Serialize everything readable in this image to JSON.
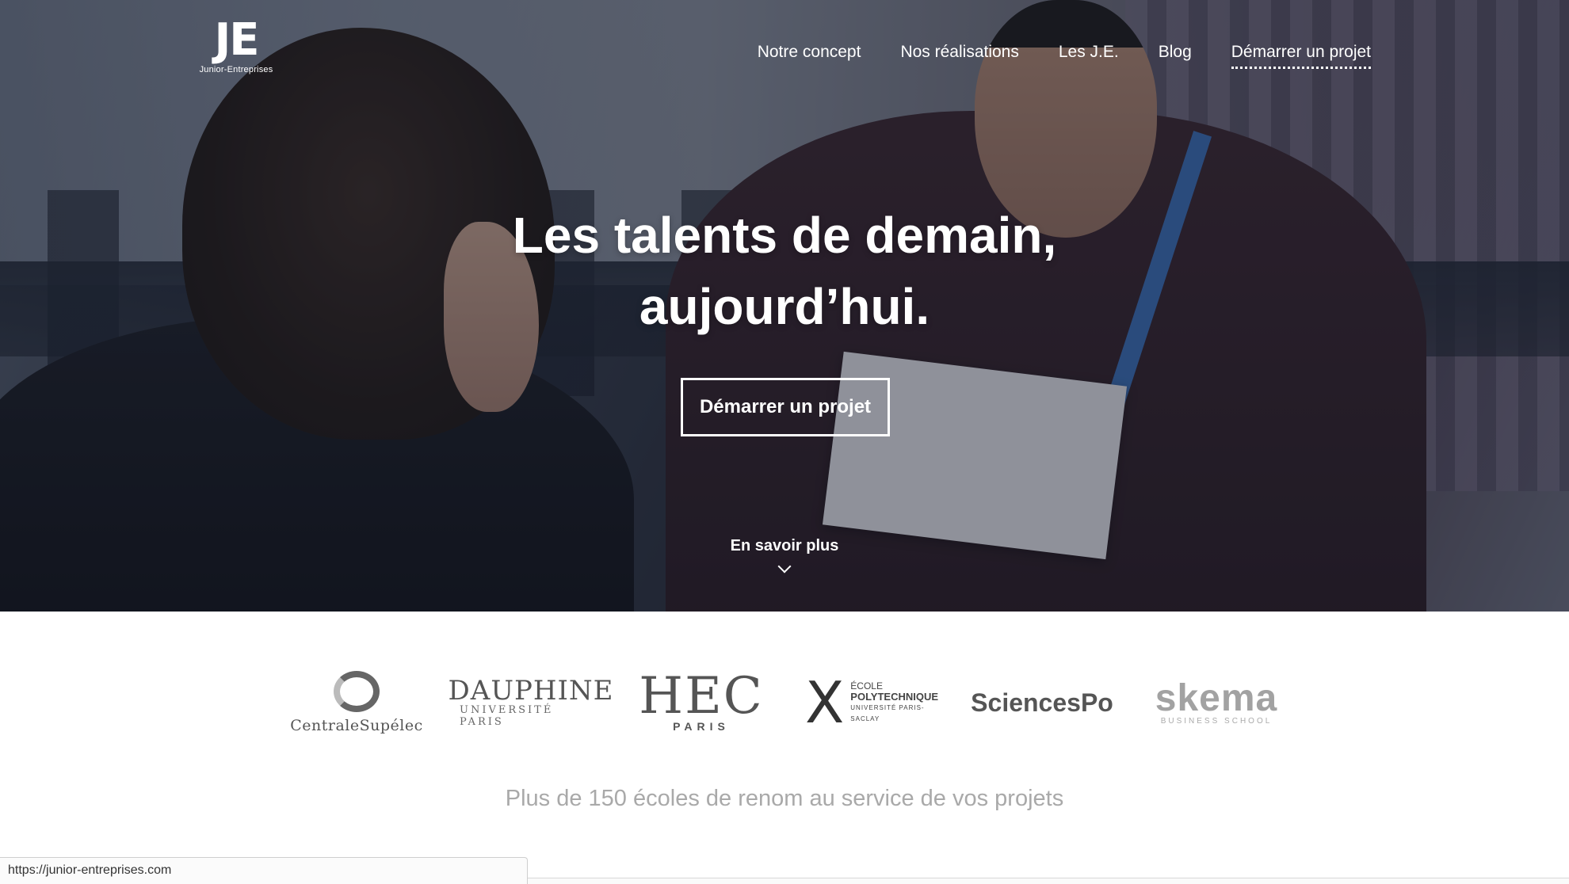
{
  "header": {
    "logo": {
      "mark": "JE",
      "subtitle": "Junior-Entreprises"
    },
    "nav": [
      {
        "label": "Notre concept"
      },
      {
        "label": "Nos réalisations"
      },
      {
        "label": "Les J.E."
      },
      {
        "label": "Blog"
      },
      {
        "label": "Démarrer un projet",
        "active": true
      }
    ]
  },
  "hero": {
    "title_line1": "Les talents de demain,",
    "title_line2": "aujourd’hui.",
    "cta_label": "Démarrer un projet",
    "more_label": "En savoir plus",
    "more_icon": "chevron-down-icon"
  },
  "schools": {
    "logos": {
      "centrale": {
        "name": "CentraleSupélec"
      },
      "dauphine": {
        "name": "DAUPHINE",
        "sub": "UNIVERSITÉ PARIS"
      },
      "hec": {
        "name": "HEC",
        "sub": "PARIS"
      },
      "polytechnique": {
        "mark": "X",
        "line1": "ÉCOLE",
        "line2": "POLYTECHNIQUE",
        "line3": "UNIVERSITÉ PARIS-SACLAY"
      },
      "sciencespo": {
        "name": "SciencesPo"
      },
      "skema": {
        "name": "skema",
        "sub": "BUSINESS SCHOOL"
      }
    },
    "caption": "Plus de 150 écoles de renom au service de vos projets"
  },
  "statusbar": {
    "url": "https://junior-entreprises.com"
  },
  "colors": {
    "text_white": "#ffffff",
    "caption_gray": "#a9a9a9",
    "overlay": "#141826"
  }
}
